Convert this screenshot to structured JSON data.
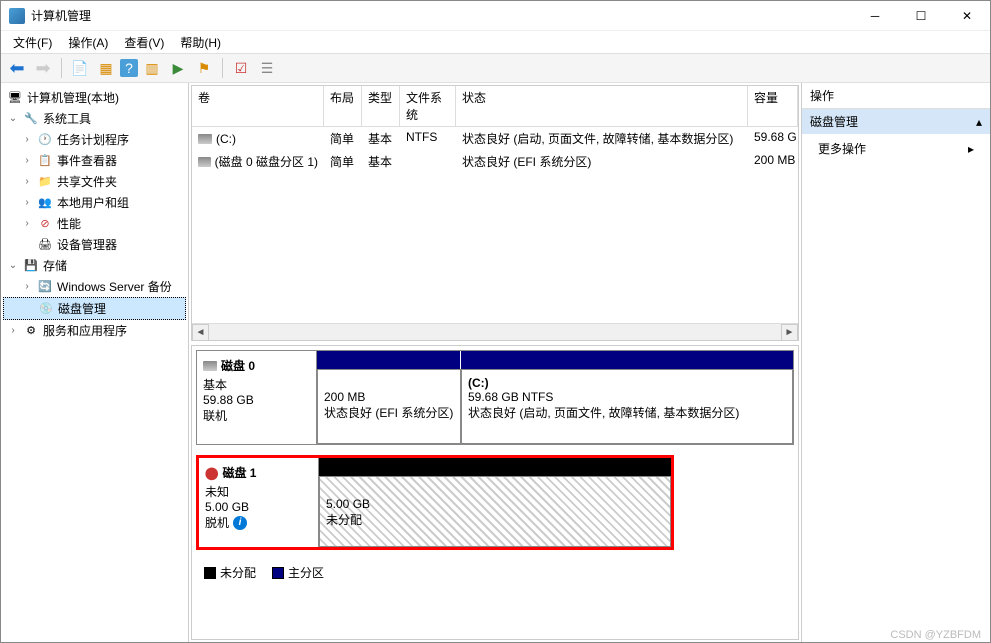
{
  "window": {
    "title": "计算机管理"
  },
  "menu": {
    "file": "文件(F)",
    "action": "操作(A)",
    "view": "查看(V)",
    "help": "帮助(H)"
  },
  "tree": {
    "root": "计算机管理(本地)",
    "system_tools": "系统工具",
    "task_scheduler": "任务计划程序",
    "event_viewer": "事件查看器",
    "shared_folders": "共享文件夹",
    "local_users": "本地用户和组",
    "performance": "性能",
    "device_manager": "设备管理器",
    "storage": "存储",
    "win_backup": "Windows Server 备份",
    "disk_mgmt": "磁盘管理",
    "services_apps": "服务和应用程序"
  },
  "volume_table": {
    "headers": {
      "volume": "卷",
      "layout": "布局",
      "type": "类型",
      "fs": "文件系统",
      "status": "状态",
      "capacity": "容量"
    },
    "rows": [
      {
        "volume": "(C:)",
        "layout": "简单",
        "type": "基本",
        "fs": "NTFS",
        "status": "状态良好 (启动, 页面文件, 故障转储, 基本数据分区)",
        "capacity": "59.68 G"
      },
      {
        "volume": "(磁盘 0 磁盘分区 1)",
        "layout": "简单",
        "type": "基本",
        "fs": "",
        "status": "状态良好 (EFI 系统分区)",
        "capacity": "200 MB"
      }
    ]
  },
  "disks": {
    "disk0": {
      "name": "磁盘 0",
      "type": "基本",
      "size": "59.88 GB",
      "status": "联机",
      "partitions": [
        {
          "label": "",
          "size": "200 MB",
          "status": "状态良好 (EFI 系统分区)"
        },
        {
          "label": "(C:)",
          "size": "59.68 GB NTFS",
          "status": "状态良好 (启动, 页面文件, 故障转储, 基本数据分区)"
        }
      ]
    },
    "disk1": {
      "name": "磁盘 1",
      "type": "未知",
      "size": "5.00 GB",
      "status": "脱机",
      "partition": {
        "size": "5.00 GB",
        "status": "未分配"
      }
    }
  },
  "legend": {
    "unalloc": "未分配",
    "primary": "主分区"
  },
  "actions": {
    "title": "操作",
    "section": "磁盘管理",
    "more": "更多操作"
  },
  "watermark": "CSDN @YZBFDM"
}
